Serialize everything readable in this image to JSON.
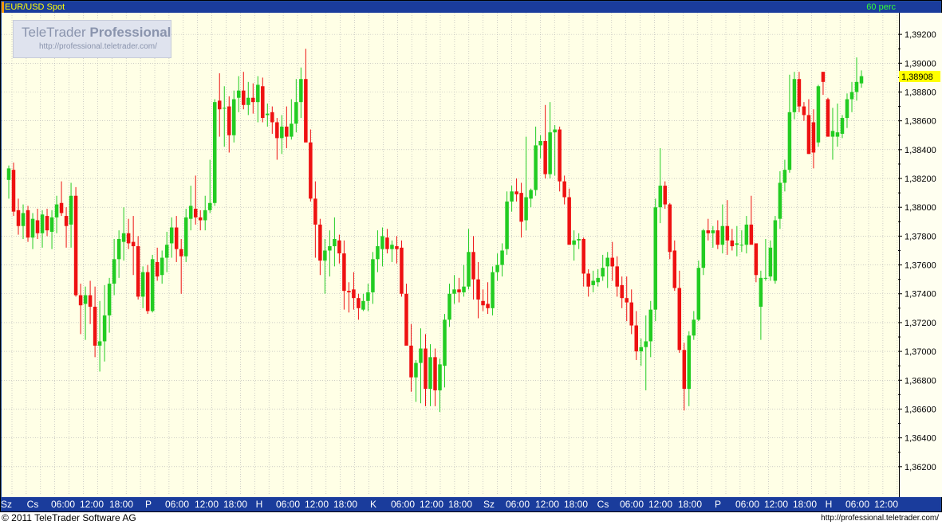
{
  "header": {
    "symbol": "EUR/USD Spot",
    "interval": "60 perc"
  },
  "logo": {
    "brand_normal": "TeleTrader ",
    "brand_bold": "Professional",
    "url": "http://professional.teletrader.com/"
  },
  "footer": {
    "copyright": "© 2011 TeleTrader Software AG",
    "url": "http://professional.teletrader.com/"
  },
  "colors": {
    "up": "#22cc22",
    "down": "#ee1111",
    "background": "#ffffe6",
    "frame": "#1a3c9c",
    "last_price_bg": "#ffff00"
  },
  "chart_data": {
    "type": "candlestick",
    "title": "EUR/USD Spot",
    "interval": "60 perc",
    "ylim": [
      1.36,
      1.3935
    ],
    "y_ticks": [
      "1,36200",
      "1,36400",
      "1,36600",
      "1,36800",
      "1,37000",
      "1,37200",
      "1,37400",
      "1,37600",
      "1,37800",
      "1,38000",
      "1,38200",
      "1,38400",
      "1,38600",
      "1,38800",
      "1,39000",
      "1,39200"
    ],
    "last_price": "1,38908",
    "grid": true,
    "x_labels": [
      "Sz",
      "Cs",
      "06:00",
      "12:00",
      "18:00",
      "P",
      "06:00",
      "12:00",
      "18:00",
      "H",
      "06:00",
      "12:00",
      "18:00",
      "K",
      "06:00",
      "12:00",
      "18:00",
      "Sz",
      "06:00",
      "12:00",
      "18:00",
      "Cs",
      "06:00",
      "12:00",
      "18:00",
      "P",
      "06:00",
      "12:00",
      "18:00",
      "H",
      "06:00",
      "12:00"
    ],
    "candles": [
      {
        "o": 1.3819,
        "h": 1.3829,
        "l": 1.3806,
        "c": 1.3827
      },
      {
        "o": 1.3826,
        "h": 1.3831,
        "l": 1.3794,
        "c": 1.3797
      },
      {
        "o": 1.3798,
        "h": 1.3806,
        "l": 1.3781,
        "c": 1.3787
      },
      {
        "o": 1.3787,
        "h": 1.3802,
        "l": 1.3778,
        "c": 1.3796
      },
      {
        "o": 1.3798,
        "h": 1.3801,
        "l": 1.3776,
        "c": 1.3779
      },
      {
        "o": 1.3779,
        "h": 1.3796,
        "l": 1.3771,
        "c": 1.3792
      },
      {
        "o": 1.3791,
        "h": 1.3799,
        "l": 1.3778,
        "c": 1.3782
      },
      {
        "o": 1.3782,
        "h": 1.3798,
        "l": 1.3772,
        "c": 1.3795
      },
      {
        "o": 1.3794,
        "h": 1.3799,
        "l": 1.378,
        "c": 1.3784
      },
      {
        "o": 1.3783,
        "h": 1.3798,
        "l": 1.3771,
        "c": 1.3793
      },
      {
        "o": 1.3793,
        "h": 1.3808,
        "l": 1.3782,
        "c": 1.3802
      },
      {
        "o": 1.3803,
        "h": 1.3818,
        "l": 1.3794,
        "c": 1.3796
      },
      {
        "o": 1.3794,
        "h": 1.38,
        "l": 1.3772,
        "c": 1.3787
      },
      {
        "o": 1.3788,
        "h": 1.3817,
        "l": 1.3772,
        "c": 1.3808
      },
      {
        "o": 1.3808,
        "h": 1.3814,
        "l": 1.3738,
        "c": 1.3739
      },
      {
        "o": 1.3739,
        "h": 1.3747,
        "l": 1.3712,
        "c": 1.3732
      },
      {
        "o": 1.3733,
        "h": 1.3745,
        "l": 1.3708,
        "c": 1.3739
      },
      {
        "o": 1.3739,
        "h": 1.3749,
        "l": 1.3719,
        "c": 1.3731
      },
      {
        "o": 1.3731,
        "h": 1.3745,
        "l": 1.3696,
        "c": 1.3704
      },
      {
        "o": 1.3704,
        "h": 1.3735,
        "l": 1.3686,
        "c": 1.3707
      },
      {
        "o": 1.3707,
        "h": 1.3746,
        "l": 1.3693,
        "c": 1.3725
      },
      {
        "o": 1.3725,
        "h": 1.3751,
        "l": 1.3713,
        "c": 1.3747
      },
      {
        "o": 1.3747,
        "h": 1.3778,
        "l": 1.3739,
        "c": 1.3764
      },
      {
        "o": 1.3764,
        "h": 1.3784,
        "l": 1.3751,
        "c": 1.3778
      },
      {
        "o": 1.3776,
        "h": 1.38,
        "l": 1.3763,
        "c": 1.3782
      },
      {
        "o": 1.3782,
        "h": 1.3792,
        "l": 1.3771,
        "c": 1.3775
      },
      {
        "o": 1.3776,
        "h": 1.3794,
        "l": 1.3753,
        "c": 1.3773
      },
      {
        "o": 1.3773,
        "h": 1.378,
        "l": 1.3736,
        "c": 1.3738
      },
      {
        "o": 1.3738,
        "h": 1.3759,
        "l": 1.373,
        "c": 1.3755
      },
      {
        "o": 1.3755,
        "h": 1.376,
        "l": 1.3726,
        "c": 1.3728
      },
      {
        "o": 1.3728,
        "h": 1.3767,
        "l": 1.3727,
        "c": 1.3764
      },
      {
        "o": 1.3762,
        "h": 1.3772,
        "l": 1.3749,
        "c": 1.3752
      },
      {
        "o": 1.3753,
        "h": 1.377,
        "l": 1.3747,
        "c": 1.3765
      },
      {
        "o": 1.3765,
        "h": 1.3783,
        "l": 1.3755,
        "c": 1.3774
      },
      {
        "o": 1.3775,
        "h": 1.3793,
        "l": 1.3765,
        "c": 1.3786
      },
      {
        "o": 1.3786,
        "h": 1.3794,
        "l": 1.3762,
        "c": 1.3771
      },
      {
        "o": 1.3771,
        "h": 1.3778,
        "l": 1.374,
        "c": 1.3766
      },
      {
        "o": 1.3766,
        "h": 1.3799,
        "l": 1.3762,
        "c": 1.3793
      },
      {
        "o": 1.3792,
        "h": 1.3815,
        "l": 1.3784,
        "c": 1.3801
      },
      {
        "o": 1.3799,
        "h": 1.3822,
        "l": 1.3788,
        "c": 1.3793
      },
      {
        "o": 1.3793,
        "h": 1.3798,
        "l": 1.3784,
        "c": 1.3791
      },
      {
        "o": 1.3791,
        "h": 1.3808,
        "l": 1.3784,
        "c": 1.3798
      },
      {
        "o": 1.3798,
        "h": 1.3833,
        "l": 1.3796,
        "c": 1.3803
      },
      {
        "o": 1.3803,
        "h": 1.3875,
        "l": 1.3801,
        "c": 1.3873
      },
      {
        "o": 1.3874,
        "h": 1.3893,
        "l": 1.3849,
        "c": 1.3868
      },
      {
        "o": 1.3869,
        "h": 1.3884,
        "l": 1.3842,
        "c": 1.3869
      },
      {
        "o": 1.387,
        "h": 1.3877,
        "l": 1.3838,
        "c": 1.385
      },
      {
        "o": 1.385,
        "h": 1.3881,
        "l": 1.3845,
        "c": 1.3875
      },
      {
        "o": 1.3876,
        "h": 1.3891,
        "l": 1.3866,
        "c": 1.3881
      },
      {
        "o": 1.3881,
        "h": 1.3894,
        "l": 1.3868,
        "c": 1.3871
      },
      {
        "o": 1.3871,
        "h": 1.3887,
        "l": 1.3864,
        "c": 1.3876
      },
      {
        "o": 1.3876,
        "h": 1.3886,
        "l": 1.3865,
        "c": 1.3873
      },
      {
        "o": 1.3873,
        "h": 1.3891,
        "l": 1.3859,
        "c": 1.3885
      },
      {
        "o": 1.3884,
        "h": 1.389,
        "l": 1.3859,
        "c": 1.3862
      },
      {
        "o": 1.3864,
        "h": 1.3872,
        "l": 1.3856,
        "c": 1.3865
      },
      {
        "o": 1.3866,
        "h": 1.387,
        "l": 1.3851,
        "c": 1.3859
      },
      {
        "o": 1.3859,
        "h": 1.3862,
        "l": 1.3833,
        "c": 1.3848
      },
      {
        "o": 1.3848,
        "h": 1.3864,
        "l": 1.3837,
        "c": 1.3856
      },
      {
        "o": 1.3856,
        "h": 1.387,
        "l": 1.3841,
        "c": 1.3849
      },
      {
        "o": 1.3849,
        "h": 1.3875,
        "l": 1.3847,
        "c": 1.3858
      },
      {
        "o": 1.3858,
        "h": 1.3889,
        "l": 1.3852,
        "c": 1.3873
      },
      {
        "o": 1.3873,
        "h": 1.3897,
        "l": 1.3862,
        "c": 1.3889
      },
      {
        "o": 1.3889,
        "h": 1.391,
        "l": 1.3846,
        "c": 1.3845
      },
      {
        "o": 1.3845,
        "h": 1.3854,
        "l": 1.3804,
        "c": 1.3806
      },
      {
        "o": 1.3806,
        "h": 1.3818,
        "l": 1.3765,
        "c": 1.3788
      },
      {
        "o": 1.3788,
        "h": 1.3792,
        "l": 1.3753,
        "c": 1.3763
      },
      {
        "o": 1.3763,
        "h": 1.3778,
        "l": 1.374,
        "c": 1.377
      },
      {
        "o": 1.377,
        "h": 1.3784,
        "l": 1.3752,
        "c": 1.3773
      },
      {
        "o": 1.3773,
        "h": 1.3793,
        "l": 1.3759,
        "c": 1.3778
      },
      {
        "o": 1.3777,
        "h": 1.3781,
        "l": 1.3761,
        "c": 1.3768
      },
      {
        "o": 1.3768,
        "h": 1.3777,
        "l": 1.3729,
        "c": 1.3742
      },
      {
        "o": 1.3742,
        "h": 1.3748,
        "l": 1.3727,
        "c": 1.3741
      },
      {
        "o": 1.3743,
        "h": 1.3755,
        "l": 1.3729,
        "c": 1.3737
      },
      {
        "o": 1.3737,
        "h": 1.374,
        "l": 1.3722,
        "c": 1.373
      },
      {
        "o": 1.3729,
        "h": 1.374,
        "l": 1.3728,
        "c": 1.3735
      },
      {
        "o": 1.3735,
        "h": 1.3747,
        "l": 1.3728,
        "c": 1.3741
      },
      {
        "o": 1.3741,
        "h": 1.3769,
        "l": 1.3733,
        "c": 1.3764
      },
      {
        "o": 1.3764,
        "h": 1.3784,
        "l": 1.3755,
        "c": 1.3773
      },
      {
        "o": 1.3771,
        "h": 1.3786,
        "l": 1.3759,
        "c": 1.378
      },
      {
        "o": 1.3779,
        "h": 1.3785,
        "l": 1.3768,
        "c": 1.3771
      },
      {
        "o": 1.3771,
        "h": 1.3777,
        "l": 1.3762,
        "c": 1.3774
      },
      {
        "o": 1.3773,
        "h": 1.378,
        "l": 1.3761,
        "c": 1.3771
      },
      {
        "o": 1.3772,
        "h": 1.3777,
        "l": 1.3738,
        "c": 1.374
      },
      {
        "o": 1.374,
        "h": 1.3747,
        "l": 1.3716,
        "c": 1.3704
      },
      {
        "o": 1.3704,
        "h": 1.3719,
        "l": 1.3672,
        "c": 1.3682
      },
      {
        "o": 1.3682,
        "h": 1.3694,
        "l": 1.3665,
        "c": 1.3692
      },
      {
        "o": 1.3692,
        "h": 1.3716,
        "l": 1.3664,
        "c": 1.3702
      },
      {
        "o": 1.3702,
        "h": 1.3712,
        "l": 1.3662,
        "c": 1.3674
      },
      {
        "o": 1.3674,
        "h": 1.3705,
        "l": 1.3662,
        "c": 1.3696
      },
      {
        "o": 1.3696,
        "h": 1.3702,
        "l": 1.3662,
        "c": 1.3673
      },
      {
        "o": 1.3673,
        "h": 1.3695,
        "l": 1.3658,
        "c": 1.3691
      },
      {
        "o": 1.369,
        "h": 1.3726,
        "l": 1.3675,
        "c": 1.3722
      },
      {
        "o": 1.3722,
        "h": 1.3747,
        "l": 1.3717,
        "c": 1.374
      },
      {
        "o": 1.374,
        "h": 1.3753,
        "l": 1.3733,
        "c": 1.3743
      },
      {
        "o": 1.3743,
        "h": 1.3751,
        "l": 1.3734,
        "c": 1.3741
      },
      {
        "o": 1.3741,
        "h": 1.376,
        "l": 1.3738,
        "c": 1.3745
      },
      {
        "o": 1.3745,
        "h": 1.3785,
        "l": 1.3743,
        "c": 1.3769
      },
      {
        "o": 1.3769,
        "h": 1.378,
        "l": 1.3736,
        "c": 1.375
      },
      {
        "o": 1.375,
        "h": 1.3762,
        "l": 1.3723,
        "c": 1.3736
      },
      {
        "o": 1.3735,
        "h": 1.3743,
        "l": 1.3728,
        "c": 1.3732
      },
      {
        "o": 1.3733,
        "h": 1.3748,
        "l": 1.3726,
        "c": 1.373
      },
      {
        "o": 1.373,
        "h": 1.3759,
        "l": 1.3725,
        "c": 1.3755
      },
      {
        "o": 1.3755,
        "h": 1.3768,
        "l": 1.3749,
        "c": 1.376
      },
      {
        "o": 1.376,
        "h": 1.3775,
        "l": 1.3752,
        "c": 1.377
      },
      {
        "o": 1.3771,
        "h": 1.3811,
        "l": 1.3767,
        "c": 1.3804
      },
      {
        "o": 1.3804,
        "h": 1.3815,
        "l": 1.3797,
        "c": 1.3811
      },
      {
        "o": 1.3811,
        "h": 1.382,
        "l": 1.3804,
        "c": 1.3809
      },
      {
        "o": 1.381,
        "h": 1.3817,
        "l": 1.3779,
        "c": 1.379
      },
      {
        "o": 1.3791,
        "h": 1.3849,
        "l": 1.3784,
        "c": 1.3807
      },
      {
        "o": 1.3806,
        "h": 1.3813,
        "l": 1.38,
        "c": 1.3812
      },
      {
        "o": 1.3812,
        "h": 1.3856,
        "l": 1.3808,
        "c": 1.3843
      },
      {
        "o": 1.3843,
        "h": 1.385,
        "l": 1.3834,
        "c": 1.3846
      },
      {
        "o": 1.3846,
        "h": 1.3871,
        "l": 1.382,
        "c": 1.3823
      },
      {
        "o": 1.3823,
        "h": 1.3873,
        "l": 1.382,
        "c": 1.3852
      },
      {
        "o": 1.3852,
        "h": 1.3857,
        "l": 1.3822,
        "c": 1.3854
      },
      {
        "o": 1.3854,
        "h": 1.3856,
        "l": 1.3811,
        "c": 1.3818
      },
      {
        "o": 1.3818,
        "h": 1.3822,
        "l": 1.3802,
        "c": 1.3807
      },
      {
        "o": 1.3807,
        "h": 1.3813,
        "l": 1.3787,
        "c": 1.3774
      },
      {
        "o": 1.3774,
        "h": 1.3784,
        "l": 1.3763,
        "c": 1.3777
      },
      {
        "o": 1.3777,
        "h": 1.3782,
        "l": 1.3771,
        "c": 1.3778
      },
      {
        "o": 1.3778,
        "h": 1.3779,
        "l": 1.3745,
        "c": 1.3754
      },
      {
        "o": 1.3754,
        "h": 1.3757,
        "l": 1.3738,
        "c": 1.3745
      },
      {
        "o": 1.3746,
        "h": 1.3756,
        "l": 1.3741,
        "c": 1.3749
      },
      {
        "o": 1.3748,
        "h": 1.3757,
        "l": 1.3745,
        "c": 1.3751
      },
      {
        "o": 1.3752,
        "h": 1.3767,
        "l": 1.3749,
        "c": 1.3758
      },
      {
        "o": 1.3759,
        "h": 1.3769,
        "l": 1.3744,
        "c": 1.3765
      },
      {
        "o": 1.3765,
        "h": 1.3776,
        "l": 1.3749,
        "c": 1.3759
      },
      {
        "o": 1.3759,
        "h": 1.3766,
        "l": 1.3738,
        "c": 1.3745
      },
      {
        "o": 1.3746,
        "h": 1.3752,
        "l": 1.373,
        "c": 1.3737
      },
      {
        "o": 1.3737,
        "h": 1.3752,
        "l": 1.3721,
        "c": 1.3734
      },
      {
        "o": 1.3734,
        "h": 1.3743,
        "l": 1.3712,
        "c": 1.3718
      },
      {
        "o": 1.3718,
        "h": 1.3728,
        "l": 1.3694,
        "c": 1.37
      },
      {
        "o": 1.37,
        "h": 1.3709,
        "l": 1.369,
        "c": 1.3703
      },
      {
        "o": 1.3703,
        "h": 1.3725,
        "l": 1.3673,
        "c": 1.3707
      },
      {
        "o": 1.3707,
        "h": 1.3735,
        "l": 1.3696,
        "c": 1.3729
      },
      {
        "o": 1.3729,
        "h": 1.3806,
        "l": 1.3721,
        "c": 1.38
      },
      {
        "o": 1.38,
        "h": 1.3841,
        "l": 1.3789,
        "c": 1.3815
      },
      {
        "o": 1.3815,
        "h": 1.3818,
        "l": 1.3799,
        "c": 1.3802
      },
      {
        "o": 1.3802,
        "h": 1.3803,
        "l": 1.3764,
        "c": 1.3769
      },
      {
        "o": 1.377,
        "h": 1.3777,
        "l": 1.3742,
        "c": 1.3744
      },
      {
        "o": 1.3744,
        "h": 1.3756,
        "l": 1.3699,
        "c": 1.3701
      },
      {
        "o": 1.3701,
        "h": 1.3706,
        "l": 1.3659,
        "c": 1.3674
      },
      {
        "o": 1.3674,
        "h": 1.3714,
        "l": 1.3662,
        "c": 1.3711
      },
      {
        "o": 1.3711,
        "h": 1.3728,
        "l": 1.3708,
        "c": 1.3722
      },
      {
        "o": 1.3722,
        "h": 1.3763,
        "l": 1.3721,
        "c": 1.3758
      },
      {
        "o": 1.3758,
        "h": 1.3785,
        "l": 1.3753,
        "c": 1.3784
      },
      {
        "o": 1.3784,
        "h": 1.3792,
        "l": 1.3777,
        "c": 1.3782
      },
      {
        "o": 1.3782,
        "h": 1.3787,
        "l": 1.3772,
        "c": 1.3784
      },
      {
        "o": 1.3784,
        "h": 1.3791,
        "l": 1.3771,
        "c": 1.3774
      },
      {
        "o": 1.3774,
        "h": 1.3802,
        "l": 1.3768,
        "c": 1.3787
      },
      {
        "o": 1.3787,
        "h": 1.3805,
        "l": 1.3767,
        "c": 1.3777
      },
      {
        "o": 1.3777,
        "h": 1.3785,
        "l": 1.377,
        "c": 1.3773
      },
      {
        "o": 1.3774,
        "h": 1.3787,
        "l": 1.3766,
        "c": 1.3775
      },
      {
        "o": 1.3774,
        "h": 1.3784,
        "l": 1.3769,
        "c": 1.3774
      },
      {
        "o": 1.3774,
        "h": 1.3794,
        "l": 1.3768,
        "c": 1.3788
      },
      {
        "o": 1.3788,
        "h": 1.3808,
        "l": 1.3779,
        "c": 1.3774
      },
      {
        "o": 1.3775,
        "h": 1.3773,
        "l": 1.3748,
        "c": 1.3753
      },
      {
        "o": 1.3731,
        "h": 1.3756,
        "l": 1.3708,
        "c": 1.3751
      },
      {
        "o": 1.3751,
        "h": 1.3778,
        "l": 1.3749,
        "c": 1.3751
      },
      {
        "o": 1.3752,
        "h": 1.3777,
        "l": 1.3749,
        "c": 1.3772
      },
      {
        "o": 1.3749,
        "h": 1.3794,
        "l": 1.3747,
        "c": 1.3791
      },
      {
        "o": 1.3792,
        "h": 1.3825,
        "l": 1.3785,
        "c": 1.3817
      },
      {
        "o": 1.3817,
        "h": 1.3833,
        "l": 1.3811,
        "c": 1.3826
      },
      {
        "o": 1.3826,
        "h": 1.3892,
        "l": 1.3824,
        "c": 1.3866
      },
      {
        "o": 1.3866,
        "h": 1.3894,
        "l": 1.3861,
        "c": 1.3889
      },
      {
        "o": 1.3889,
        "h": 1.3894,
        "l": 1.3866,
        "c": 1.387
      },
      {
        "o": 1.387,
        "h": 1.3873,
        "l": 1.386,
        "c": 1.3864
      },
      {
        "o": 1.3864,
        "h": 1.3875,
        "l": 1.3837,
        "c": 1.3837
      },
      {
        "o": 1.3859,
        "h": 1.3868,
        "l": 1.3827,
        "c": 1.3838
      },
      {
        "o": 1.3845,
        "h": 1.3885,
        "l": 1.3842,
        "c": 1.3884
      },
      {
        "o": 1.3894,
        "h": 1.3894,
        "l": 1.3878,
        "c": 1.3887
      },
      {
        "o": 1.3875,
        "h": 1.3876,
        "l": 1.3849,
        "c": 1.3849
      },
      {
        "o": 1.3849,
        "h": 1.3869,
        "l": 1.3833,
        "c": 1.3853
      },
      {
        "o": 1.3849,
        "h": 1.3872,
        "l": 1.3842,
        "c": 1.3852
      },
      {
        "o": 1.3851,
        "h": 1.3864,
        "l": 1.3848,
        "c": 1.3862
      },
      {
        "o": 1.3862,
        "h": 1.3879,
        "l": 1.3855,
        "c": 1.3875
      },
      {
        "o": 1.3875,
        "h": 1.3887,
        "l": 1.3866,
        "c": 1.388
      },
      {
        "o": 1.388,
        "h": 1.3904,
        "l": 1.3874,
        "c": 1.3887
      },
      {
        "o": 1.3886,
        "h": 1.3895,
        "l": 1.3883,
        "c": 1.3891
      }
    ]
  }
}
